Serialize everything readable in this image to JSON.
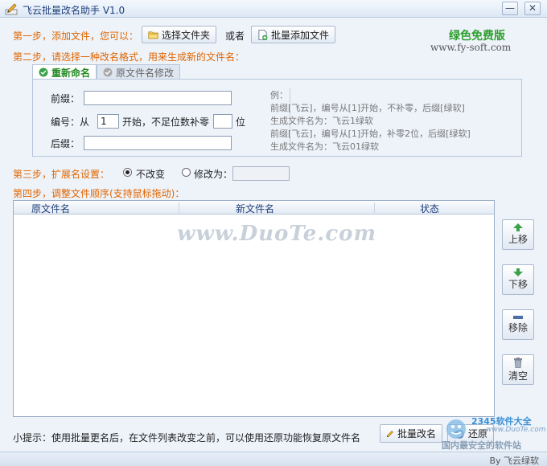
{
  "window": {
    "title": "飞云批量改名助手 V1.0",
    "minimize": "—",
    "close": "✕"
  },
  "step1": {
    "label": "第一步，添加文件，您可以：",
    "select_folder": "选择文件夹",
    "or": "或者",
    "batch_add": "批量添加文件"
  },
  "brand": {
    "name": "绿色免费版",
    "website": "www.fy-soft.com"
  },
  "step2": {
    "label": "第二步，请选择一种改名格式，用来生成新的文件名：",
    "tabs": [
      {
        "label": "重新命名"
      },
      {
        "label": "原文件名修改"
      }
    ],
    "prefix_label": "前缀：",
    "prefix_value": "",
    "number_label": "编号：从",
    "number_start": "1",
    "number_mid": "开始，不足位数补零",
    "pad_value": "",
    "number_unit": "位",
    "suffix_label": "后缀：",
    "suffix_value": "",
    "example_title": "例：",
    "example_lines": [
      "前缀[飞云]，编号从[1]开始，不补零，后缀[绿软]",
      "生成文件名为：飞云1绿软",
      "前缀[飞云]，编号从[1]开始，补零2位，后缀[绿软]",
      "生成文件名为：飞云01绿软"
    ]
  },
  "step3": {
    "label": "第三步，扩展名设置：",
    "no_change": "不改变",
    "change_to": "修改为：",
    "change_value": ""
  },
  "step4": {
    "label": "第四步，调整文件顺序(支持鼠标拖动)：",
    "columns": [
      "原文件名",
      "新文件名",
      "状态"
    ]
  },
  "watermark": "www.DuoTe.com",
  "side_buttons": {
    "up": "上移",
    "down": "下移",
    "remove": "移除",
    "clear": "清空"
  },
  "bottom": {
    "tip": "小提示：使用批量更名后，在文件列表改变之前，可以使用还原功能恢复原文件名",
    "batch_rename": "批量改名",
    "restore": "还原"
  },
  "logo": {
    "title": "2345软件大全",
    "url": "www.DuoTe.com",
    "slogan": "国内最安全的软件站"
  },
  "status": {
    "credit": "By 飞云绿软"
  },
  "colors": {
    "step_orange": "#e06600",
    "brand_green": "#2f9e2f",
    "tab_active_green": "#218a21"
  }
}
